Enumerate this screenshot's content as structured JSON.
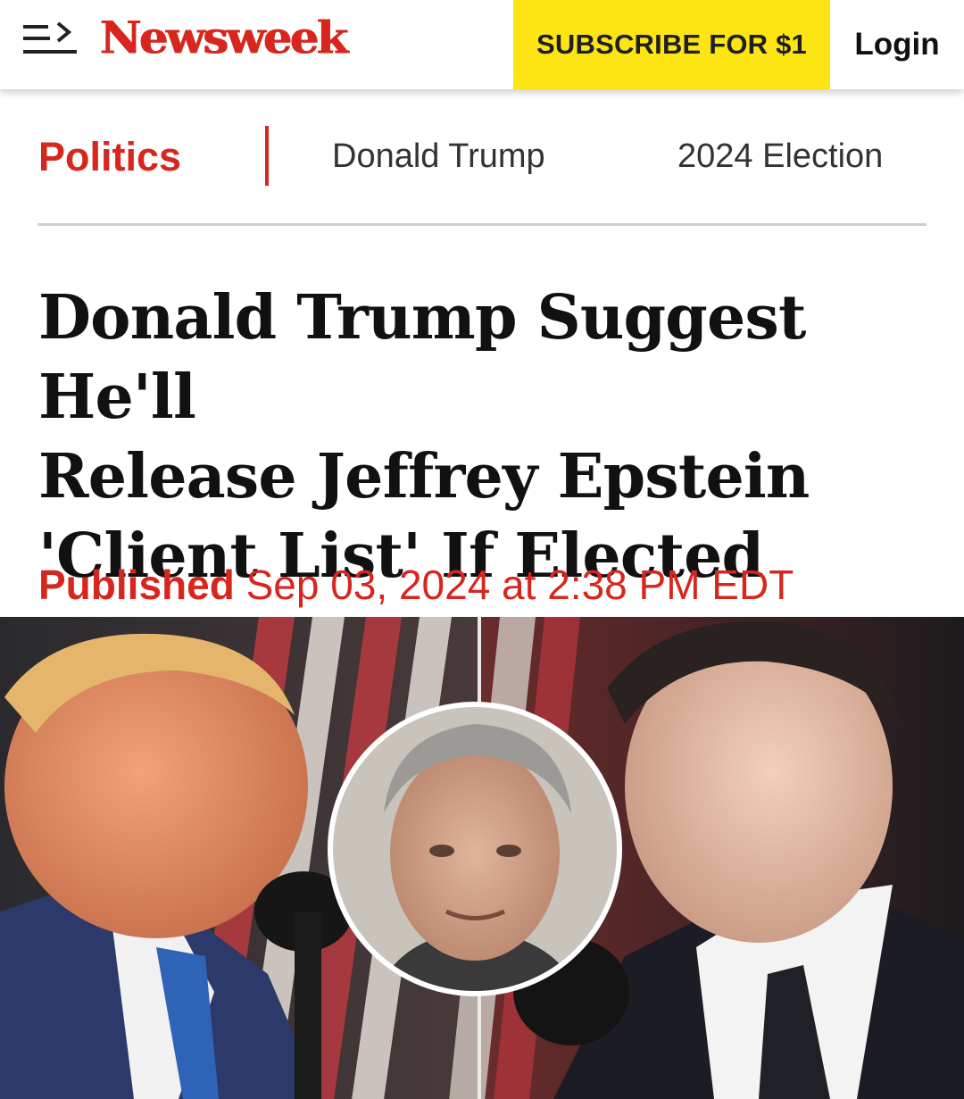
{
  "header": {
    "brand": "Newsweek",
    "menu_icon": "menu-arrow-icon",
    "subscribe_label": "SUBSCRIBE FOR $1",
    "login_label": "Login"
  },
  "category_nav": {
    "primary": "Politics",
    "links": [
      "Donald Trump",
      "2024 Election"
    ]
  },
  "article": {
    "headline_lines": [
      "Donald Trump Suggest He'll",
      "Release Jeffrey Epstein",
      "'Client List' If Elected"
    ],
    "published_label": "Published",
    "published_date": "Sep 03, 2024 at 2:38 PM EDT"
  },
  "colors": {
    "brand_red": "#d7261e",
    "subscribe_yellow": "#fde513",
    "rule_gray": "#cfcfcf",
    "headline_text": "#111111"
  }
}
